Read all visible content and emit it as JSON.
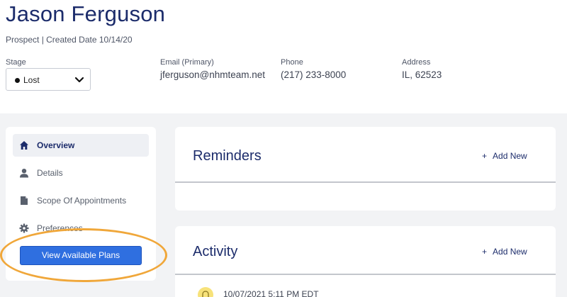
{
  "contact": {
    "name": "Jason Ferguson",
    "subline": "Prospect | Created Date  10/14/20"
  },
  "fields": {
    "stage": {
      "label": "Stage",
      "value": "Lost"
    },
    "email": {
      "label": "Email (Primary)",
      "value": "jferguson@nhmteam.net"
    },
    "phone": {
      "label": "Phone",
      "value": "(217) 233-8000"
    },
    "address": {
      "label": "Address",
      "value": "IL, 62523"
    }
  },
  "sidebar": {
    "items": [
      {
        "label": "Overview",
        "icon": "home-icon",
        "active": true
      },
      {
        "label": "Details",
        "icon": "person-icon",
        "active": false
      },
      {
        "label": "Scope Of Appointments",
        "icon": "document-icon",
        "active": false
      },
      {
        "label": "Preferences",
        "icon": "gear-icon",
        "active": false
      }
    ],
    "plans_button": "View Available Plans"
  },
  "reminders": {
    "title": "Reminders",
    "add_new": "Add New"
  },
  "activity": {
    "title": "Activity",
    "add_new": "Add New",
    "entries": [
      {
        "timestamp": "10/07/2021 5:11 PM EDT",
        "icon": "bell-icon"
      }
    ]
  },
  "colors": {
    "brand_navy": "#1c2c6b",
    "primary_button": "#2f6fe0",
    "highlight": "#f0a73a",
    "page_bg": "#f2f3f5"
  }
}
